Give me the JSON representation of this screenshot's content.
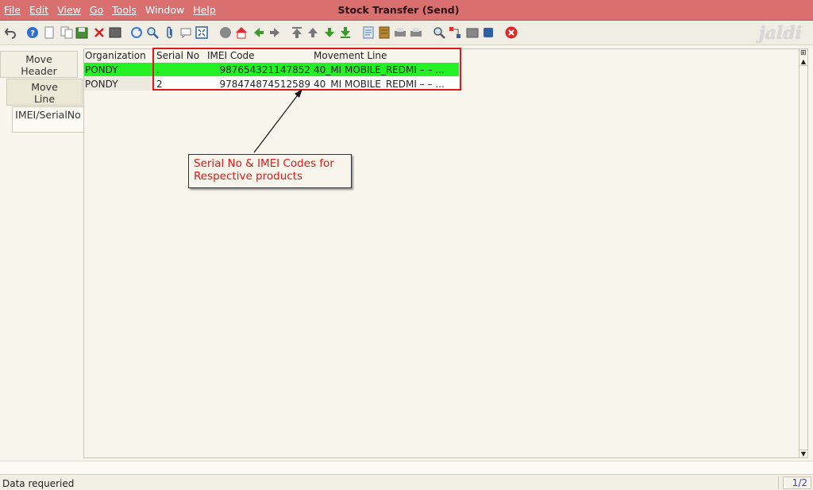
{
  "window": {
    "title": "Stock Transfer (Send)"
  },
  "menu": [
    {
      "label": "File"
    },
    {
      "label": "Edit"
    },
    {
      "label": "View"
    },
    {
      "label": "Go"
    },
    {
      "label": "Tools"
    },
    {
      "label": "Window"
    },
    {
      "label": "Help"
    }
  ],
  "brand": {
    "text": "jaldi"
  },
  "toolbar": {
    "icons": [
      "undo-icon",
      "help-icon",
      "new-record-icon",
      "copy-record-icon",
      "save-icon",
      "delete-icon",
      "refresh-icon",
      "sync-icon",
      "find-icon",
      "attachment-icon",
      "chat-icon",
      "zoom-fit-icon",
      "history-icon",
      "home-icon",
      "back-icon",
      "forward-icon",
      "first-record-icon",
      "previous-record-icon",
      "next-record-icon",
      "last-record-icon",
      "report-icon",
      "archive-icon",
      "print-preview-icon",
      "print-icon",
      "zoom-across-icon",
      "workflow-icon",
      "product-info-icon",
      "save-db-icon",
      "close-window-icon"
    ]
  },
  "tabs": [
    {
      "label_1": "Move",
      "label_2": "Header"
    },
    {
      "label_1": "Move",
      "label_2": "Line"
    },
    {
      "label_1": "IMEI/SerialNo"
    }
  ],
  "grid": {
    "columns": [
      "Organization",
      "Serial No",
      "IMEI Code",
      "Movement Line"
    ],
    "rows": [
      {
        "organization": "PONDY",
        "serial_no": ".",
        "imei_code": "987654321147852",
        "movement_line": "40_MI MOBILE_REDMI –  –  ..."
      },
      {
        "organization": "PONDY",
        "serial_no": "2",
        "imei_code": "978474874512589",
        "movement_line": "40_MI MOBILE_REDMI –  –  ..."
      }
    ],
    "selected_row_color": "#25f025"
  },
  "annotation": {
    "text_line_1": "Serial No & IMEI Codes for",
    "text_line_2": "Respective products",
    "color": "#e01818"
  },
  "status": {
    "message": "Data requeried",
    "page": "1/2"
  },
  "colors": {
    "titlebar": "#d96f6f",
    "background": "#f7f5ec"
  }
}
